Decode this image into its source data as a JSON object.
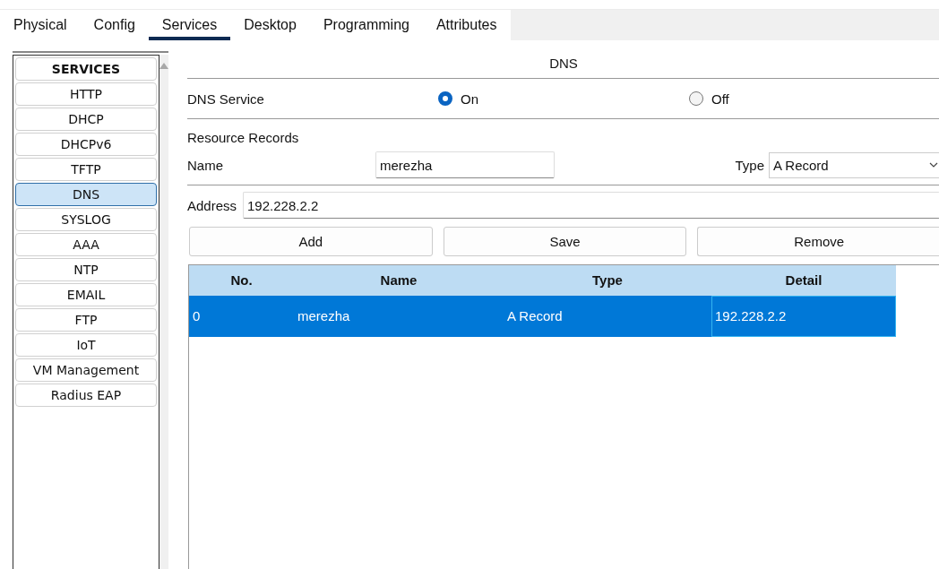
{
  "tabs": [
    {
      "label": "Physical",
      "selected": false
    },
    {
      "label": "Config",
      "selected": false
    },
    {
      "label": "Services",
      "selected": true
    },
    {
      "label": "Desktop",
      "selected": false
    },
    {
      "label": "Programming",
      "selected": false
    },
    {
      "label": "Attributes",
      "selected": false
    }
  ],
  "sidebar": {
    "items": [
      {
        "label": "SERVICES",
        "kind": "header",
        "selected": false
      },
      {
        "label": "HTTP",
        "kind": "item",
        "selected": false
      },
      {
        "label": "DHCP",
        "kind": "item",
        "selected": false
      },
      {
        "label": "DHCPv6",
        "kind": "item",
        "selected": false
      },
      {
        "label": "TFTP",
        "kind": "item",
        "selected": false
      },
      {
        "label": "DNS",
        "kind": "item",
        "selected": true
      },
      {
        "label": "SYSLOG",
        "kind": "item",
        "selected": false
      },
      {
        "label": "AAA",
        "kind": "item",
        "selected": false
      },
      {
        "label": "NTP",
        "kind": "item",
        "selected": false
      },
      {
        "label": "EMAIL",
        "kind": "item",
        "selected": false
      },
      {
        "label": "FTP",
        "kind": "item",
        "selected": false
      },
      {
        "label": "IoT",
        "kind": "item",
        "selected": false
      },
      {
        "label": "VM Management",
        "kind": "item",
        "selected": false
      },
      {
        "label": "Radius EAP",
        "kind": "item",
        "selected": false
      }
    ]
  },
  "panel": {
    "title": "DNS",
    "service": {
      "label": "DNS Service",
      "options": [
        {
          "label": "On",
          "selected": true
        },
        {
          "label": "Off",
          "selected": false
        }
      ]
    },
    "section_label": "Resource Records",
    "name_field": {
      "label": "Name",
      "value": "merezha"
    },
    "type_field": {
      "label": "Type",
      "value": "A Record"
    },
    "address_field": {
      "label": "Address",
      "value": "192.228.2.2"
    },
    "buttons": [
      "Add",
      "Save",
      "Remove"
    ],
    "table": {
      "columns": [
        "No.",
        "Name",
        "Type",
        "Detail"
      ],
      "rows": [
        {
          "cells": [
            "0",
            "merezha",
            "A Record",
            "192.228.2.2"
          ],
          "selected": true
        }
      ]
    }
  }
}
